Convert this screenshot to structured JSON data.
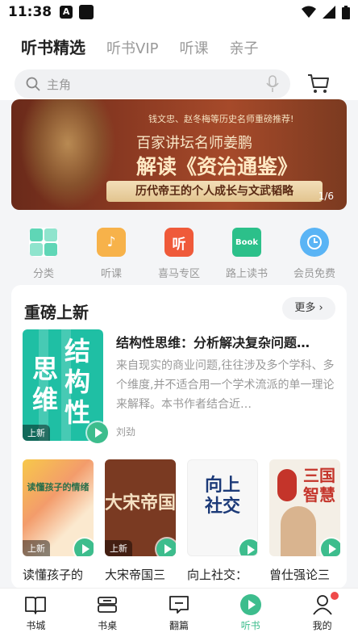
{
  "status_bar": {
    "time": "11:38",
    "a_badge": "A"
  },
  "top_tabs": [
    {
      "label": "听书精选",
      "active": true
    },
    {
      "label": "听书VIP",
      "active": false
    },
    {
      "label": "听课",
      "active": false
    },
    {
      "label": "亲子",
      "active": false
    }
  ],
  "search": {
    "placeholder": "主角"
  },
  "banner": {
    "line1": "钱文忠、赵冬梅等历史名师重磅推荐!",
    "line2": "百家讲坛名师姜鹏",
    "line3": "解读《资治通鉴》",
    "scroll_text": "历代帝王的个人成长与文武韬略",
    "pager": "1/6"
  },
  "categories": [
    {
      "label": "分类",
      "icon": "grid-icon",
      "color": "#5fd6b6",
      "glyph": "▦"
    },
    {
      "label": "听课",
      "icon": "music-note-icon",
      "color": "#f7b24a",
      "glyph": "♪"
    },
    {
      "label": "喜马专区",
      "icon": "ting-logo-icon",
      "color": "#ef5a3a",
      "glyph": "听"
    },
    {
      "label": "路上读书",
      "icon": "book-logo-icon",
      "color": "#2cc08a",
      "glyph": "Book"
    },
    {
      "label": "会员免费",
      "icon": "clock-icon",
      "color": "#5ab4f5",
      "glyph": "◔"
    }
  ],
  "section": {
    "title": "重磅上新",
    "more_label": "更多",
    "more_arrow": "›",
    "featured": {
      "cover_text": "结构性思维",
      "cover_chars": [
        "结",
        "构",
        "性",
        "思",
        "维"
      ],
      "badge": "上新",
      "title": "结构性思维：分析解决复杂问题…",
      "desc": "来自现实的商业问题,往往涉及多个学科、多个维度,并不适合用一个学术流派的单一理论来解释。本书作者结合近…",
      "author": "刘劲"
    },
    "books": [
      {
        "title": "读懂孩子的",
        "badge": "上新",
        "cover_text": "读懂孩子的情绪",
        "bg": "#fbe9cf",
        "fg": "#2a6f4a"
      },
      {
        "title": "大宋帝国三",
        "badge": "上新",
        "cover_text": "大宋帝国",
        "bg": "#7a3a22",
        "fg": "#f4e0c2"
      },
      {
        "title": "向上社交：",
        "badge": "",
        "cover_text": "向上社交",
        "bg": "#f7f7f7",
        "fg": "#1c3a78"
      },
      {
        "title": "曾仕强论三",
        "badge": "",
        "cover_text": "三国智慧",
        "bg": "#f4efe6",
        "fg": "#c4342a"
      }
    ]
  },
  "bottom_nav": [
    {
      "label": "书城",
      "icon": "book-open-icon",
      "active": false
    },
    {
      "label": "书桌",
      "icon": "bookshelf-icon",
      "active": false
    },
    {
      "label": "翻篇",
      "icon": "message-icon",
      "active": false
    },
    {
      "label": "听书",
      "icon": "play-circle-icon",
      "active": true
    },
    {
      "label": "我的",
      "icon": "user-icon",
      "active": false,
      "has_dot": true
    }
  ],
  "colors": {
    "accent": "#3dbd8d",
    "notify_dot": "#ef4a4a"
  }
}
